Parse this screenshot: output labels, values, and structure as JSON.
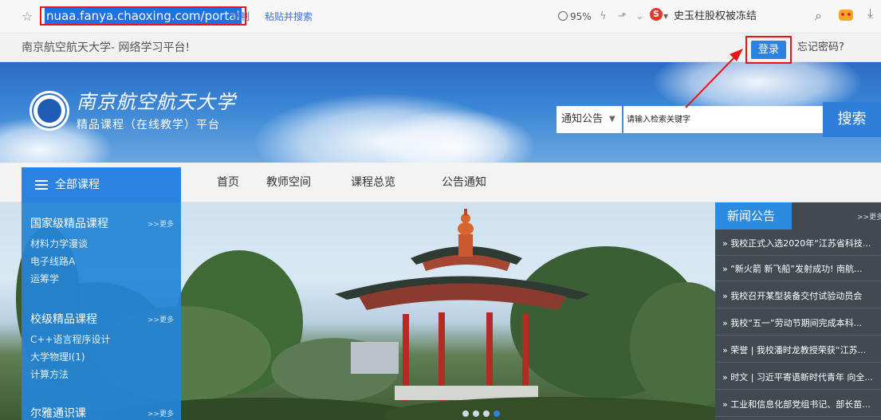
{
  "browser": {
    "url": "nuaa.fanya.chaoxing.com/portal",
    "copy_link": "复制",
    "paste_search_link": "粘贴并搜索",
    "zoom": "95%",
    "news_ticker": "史玉柱股权被冻结"
  },
  "site": {
    "title": "南京航空航天大学- 网络学习平台!",
    "login_label": "登录",
    "forgot_password_label": "忘记密码?",
    "logo_name": "南京航空航天大学",
    "logo_subtitle": "精品课程（在线教学）平台",
    "accent_color": "#2c82e0"
  },
  "search": {
    "category": "通知公告",
    "placeholder": "请输入检索关键字",
    "button_label": "搜索"
  },
  "nav": {
    "all_courses": "全部课程",
    "items": [
      "首页",
      "教师空间",
      "课程总览",
      "公告通知"
    ]
  },
  "sidebar": {
    "categories": [
      {
        "title": "国家级精品课程",
        "more": ">>更多",
        "links": [
          "材料力学漫谈",
          "电子线路A",
          "运筹学"
        ]
      },
      {
        "title": "校级精品课程",
        "more": ">>更多",
        "links": [
          "C++语言程序设计",
          "大学物理Ⅰ(1)",
          "计算方法"
        ]
      },
      {
        "title": "尔雅通识课",
        "more": ">>更多",
        "links": []
      }
    ]
  },
  "news": {
    "title": "新闻公告",
    "more": ">>更多",
    "items": [
      "» 我校正式入选2020年“江苏省科技...",
      "» “新火箭 新飞船”发射成功! 南航...",
      "» 我校召开某型装备交付试验动员会",
      "» 我校“五一”劳动节期间完成本科...",
      "» 荣誉 | 我校潘时龙教授荣获“江苏...",
      "» 时文 | 习近平寄语新时代青年 向全...",
      "» 工业和信息化部党组书记、部长苗..."
    ]
  }
}
